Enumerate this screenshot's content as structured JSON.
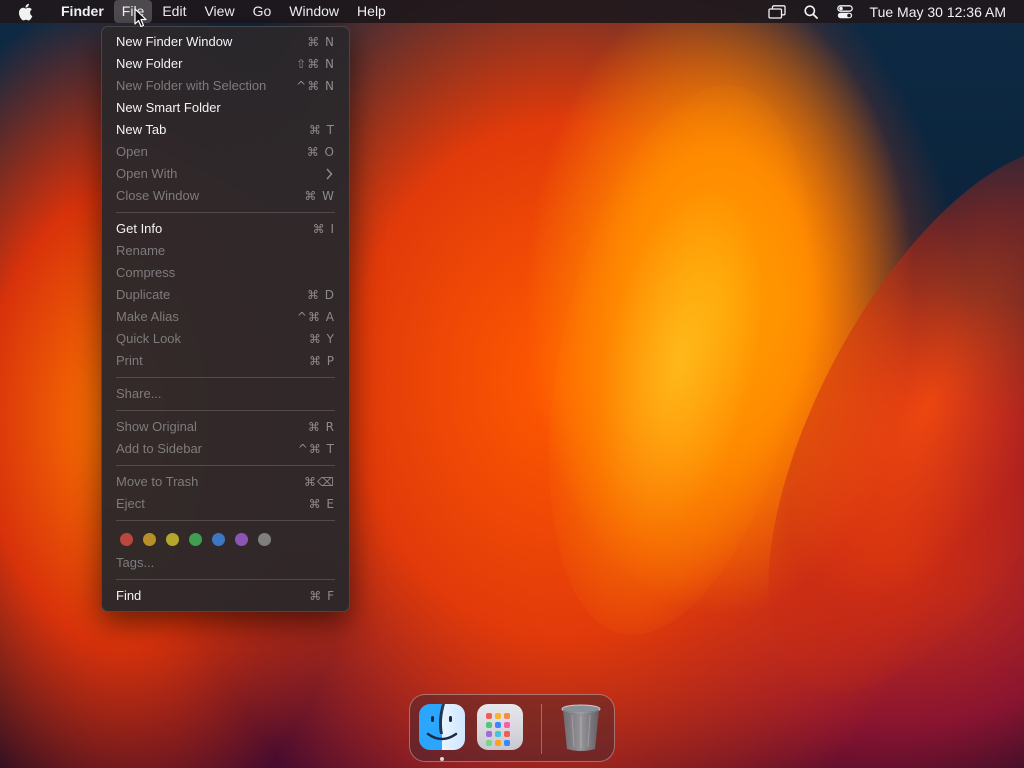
{
  "menubar": {
    "app_name": "Finder",
    "items": [
      "File",
      "Edit",
      "View",
      "Go",
      "Window",
      "Help"
    ],
    "active_item": "File",
    "clock": "Tue May 30  12:36 AM",
    "icons": [
      "apple-icon",
      "screen-mirroring-icon",
      "spotlight-search-icon",
      "control-center-icon"
    ]
  },
  "file_menu": {
    "group1": [
      {
        "label": "New Finder Window",
        "shortcut": "⌘ N",
        "enabled": true
      },
      {
        "label": "New Folder",
        "shortcut": "⇧⌘ N",
        "enabled": true
      },
      {
        "label": "New Folder with Selection",
        "shortcut": "^⌘ N",
        "enabled": false
      },
      {
        "label": "New Smart Folder",
        "shortcut": "",
        "enabled": true
      },
      {
        "label": "New Tab",
        "shortcut": "⌘ T",
        "enabled": true
      },
      {
        "label": "Open",
        "shortcut": "⌘ O",
        "enabled": false
      },
      {
        "label": "Open With",
        "shortcut": "",
        "enabled": false,
        "submenu": true
      },
      {
        "label": "Close Window",
        "shortcut": "⌘ W",
        "enabled": false
      }
    ],
    "group2": [
      {
        "label": "Get Info",
        "shortcut": "⌘ I",
        "enabled": true
      },
      {
        "label": "Rename",
        "shortcut": "",
        "enabled": false
      },
      {
        "label": "Compress",
        "shortcut": "",
        "enabled": false
      },
      {
        "label": "Duplicate",
        "shortcut": "⌘ D",
        "enabled": false
      },
      {
        "label": "Make Alias",
        "shortcut": "^⌘ A",
        "enabled": false
      },
      {
        "label": "Quick Look",
        "shortcut": "⌘ Y",
        "enabled": false
      },
      {
        "label": "Print",
        "shortcut": "⌘ P",
        "enabled": false
      }
    ],
    "group3": [
      {
        "label": "Share...",
        "shortcut": "",
        "enabled": false
      }
    ],
    "group4": [
      {
        "label": "Show Original",
        "shortcut": "⌘ R",
        "enabled": false
      },
      {
        "label": "Add to Sidebar",
        "shortcut": "^⌘ T",
        "enabled": false
      }
    ],
    "group5": [
      {
        "label": "Move to Trash",
        "shortcut": "⌘⌫",
        "enabled": false
      },
      {
        "label": "Eject",
        "shortcut": "⌘ E",
        "enabled": false
      }
    ],
    "tag_colors": [
      "#b9473f",
      "#b8902a",
      "#b3a72c",
      "#3f9e4f",
      "#3c78c2",
      "#8b55b3",
      "#7f7f7f"
    ],
    "tags_label": "Tags...",
    "group6": [
      {
        "label": "Find",
        "shortcut": "⌘ F",
        "enabled": true
      }
    ]
  },
  "dock": {
    "apps": [
      "finder-icon",
      "launchpad-icon",
      "trash-icon"
    ]
  }
}
